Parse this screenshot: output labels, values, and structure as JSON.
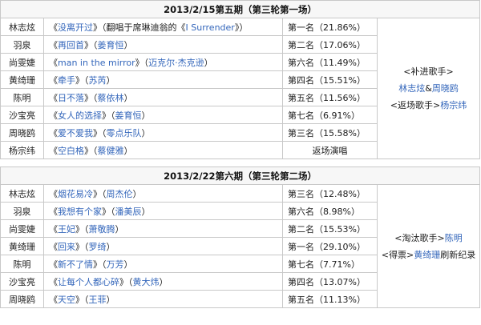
{
  "colors": {
    "link": "#3366bb",
    "text": "#222222",
    "border": "#c8c8c8",
    "header_bg": "#f7f7f7"
  },
  "episode5": {
    "title": "2013/2/15第五期（第三轮第一场）",
    "rows": [
      {
        "singer": "林志炫",
        "song_open": "《",
        "song": "没离开过",
        "song_close": "》",
        "extra1": "（翻唱于席琳迪翁的《",
        "extra_link": "I Surrender",
        "extra2": "》）",
        "rank": "第一名（21.86%）"
      },
      {
        "singer": "羽泉",
        "song_open": "《",
        "song": "再回首",
        "song_close": "》（",
        "orig": "姜育恒",
        "orig_close": "）",
        "rank": "第二名（17.06%）"
      },
      {
        "singer": "尚雯婕",
        "song_open": "《",
        "song": "man in the mirror",
        "song_close": "》（",
        "orig": "迈克尔·杰克逊",
        "orig_close": "）",
        "rank": "第六名（11.49%）"
      },
      {
        "singer": "黄绮珊",
        "song_open": "《",
        "song": "牵手",
        "song_close": "》（",
        "orig": "苏芮",
        "orig_close": "）",
        "rank": "第四名（15.51%）"
      },
      {
        "singer": "陈明",
        "song_open": "《",
        "song": "日不落",
        "song_close": "》（",
        "orig": "蔡依林",
        "orig_close": "）",
        "rank": "第五名（11.56%）"
      },
      {
        "singer": "沙宝亮",
        "song_open": "《",
        "song": "女人的选择",
        "song_close": "》（",
        "orig": "姜育恒",
        "orig_close": "）",
        "rank": "第七名（6.91%）"
      },
      {
        "singer": "周晓鸥",
        "song_open": "《",
        "song": "爱不爱我",
        "song_close": "》（",
        "orig": "零点乐队",
        "orig_close": "）",
        "rank": "第三名（15.58%）"
      },
      {
        "singer": "杨宗纬",
        "song_open": "《",
        "song": "空白格",
        "song_close": "》（",
        "orig": "蔡健雅",
        "orig_close": "）",
        "rank": "返场演唱"
      }
    ],
    "note": {
      "line1": "<补进歌手>",
      "line2_a": "林志炫",
      "line2_sep": "&",
      "line2_b": "周晓鸥",
      "line3_pre": "<返场歌手>",
      "line3_link": "杨宗纬"
    }
  },
  "episode6": {
    "title": "2013/2/22第六期（第三轮第二场）",
    "rows": [
      {
        "singer": "林志炫",
        "song_open": "《",
        "song": "烟花易冷",
        "song_close": "》（",
        "orig": "周杰伦",
        "orig_close": "）",
        "rank": "第三名（12.48%）"
      },
      {
        "singer": "羽泉",
        "song_open": "《",
        "song": "我想有个家",
        "song_close": "》（",
        "orig": "潘美辰",
        "orig_close": "）",
        "rank": "第六名（8.98%）"
      },
      {
        "singer": "尚雯婕",
        "song_open": "《",
        "song": "王妃",
        "song_close": "》（",
        "orig": "萧敬腾",
        "orig_close": "）",
        "rank": "第二名（15.53%）"
      },
      {
        "singer": "黄绮珊",
        "song_open": "《",
        "song": "回来",
        "song_close": "》（",
        "orig": "罗绮",
        "orig_close": "）",
        "rank": "第一名（29.10%）"
      },
      {
        "singer": "陈明",
        "song_open": "《",
        "song": "新不了情",
        "song_close": "》（",
        "orig": "万芳",
        "orig_close": "）",
        "rank": "第七名（7.71%）"
      },
      {
        "singer": "沙宝亮",
        "song_open": "《",
        "song": "让每个人都心碎",
        "song_close": "》（",
        "orig": "黄大炜",
        "orig_close": "）",
        "rank": "第四名（13.07%）"
      },
      {
        "singer": "周晓鸥",
        "song_open": "《",
        "song": "天空",
        "song_close": "》（",
        "orig": "王菲",
        "orig_close": "）",
        "rank": "第五名（11.13%）"
      }
    ],
    "note": {
      "line1_pre": "<淘汰歌手>",
      "line1_link": "陈明",
      "line2_pre": "<得票>",
      "line2_link": "黄绮珊",
      "line2_post": "刷新纪录"
    }
  }
}
